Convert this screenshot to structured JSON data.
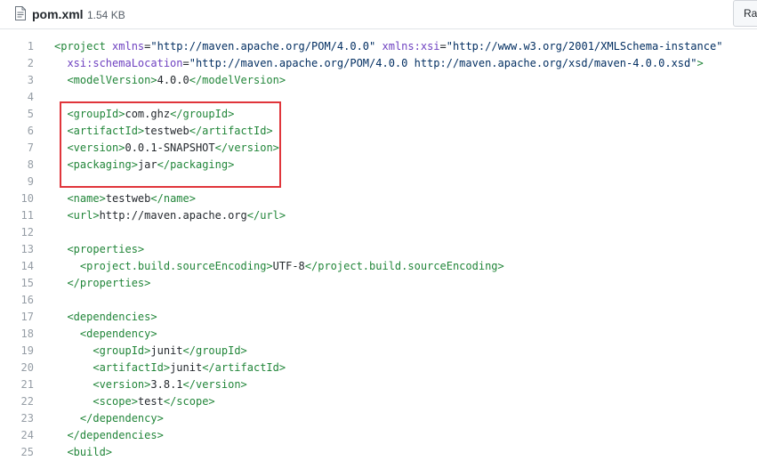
{
  "file": {
    "name": "pom.xml",
    "size": "1.54 KB",
    "raw_label": "Raw",
    "icon": "file-code-icon"
  },
  "colors": {
    "tag": "#22863a",
    "attr": "#6f42c1",
    "string": "#032f62",
    "text": "#24292e",
    "line_number": "#959da5",
    "highlight_border": "#e0353b"
  },
  "lines": [
    {
      "n": "1",
      "segs": [
        [
          "tag",
          "<project "
        ],
        [
          "attr",
          "xmlns"
        ],
        [
          "text",
          "="
        ],
        [
          "str",
          "\"http://maven.apache.org/POM/4.0.0\""
        ],
        [
          "text",
          " "
        ],
        [
          "attr",
          "xmlns:xsi"
        ],
        [
          "text",
          "="
        ],
        [
          "str",
          "\"http://www.w3.org/2001/XMLSchema-instance\""
        ]
      ]
    },
    {
      "n": "2",
      "segs": [
        [
          "text",
          "  "
        ],
        [
          "attr",
          "xsi:schemaLocation"
        ],
        [
          "text",
          "="
        ],
        [
          "str",
          "\"http://maven.apache.org/POM/4.0.0 http://maven.apache.org/xsd/maven-4.0.0.xsd\""
        ],
        [
          "tag",
          ">"
        ]
      ]
    },
    {
      "n": "3",
      "segs": [
        [
          "text",
          "  "
        ],
        [
          "tag",
          "<modelVersion>"
        ],
        [
          "text",
          "4.0.0"
        ],
        [
          "tag",
          "</modelVersion>"
        ]
      ]
    },
    {
      "n": "4",
      "segs": []
    },
    {
      "n": "5",
      "segs": [
        [
          "text",
          "  "
        ],
        [
          "tag",
          "<groupId>"
        ],
        [
          "text",
          "com.ghz"
        ],
        [
          "tag",
          "</groupId>"
        ]
      ]
    },
    {
      "n": "6",
      "segs": [
        [
          "text",
          "  "
        ],
        [
          "tag",
          "<artifactId>"
        ],
        [
          "text",
          "testweb"
        ],
        [
          "tag",
          "</artifactId>"
        ]
      ]
    },
    {
      "n": "7",
      "segs": [
        [
          "text",
          "  "
        ],
        [
          "tag",
          "<version>"
        ],
        [
          "text",
          "0.0.1-SNAPSHOT"
        ],
        [
          "tag",
          "</version>"
        ]
      ]
    },
    {
      "n": "8",
      "segs": [
        [
          "text",
          "  "
        ],
        [
          "tag",
          "<packaging>"
        ],
        [
          "text",
          "jar"
        ],
        [
          "tag",
          "</packaging>"
        ]
      ]
    },
    {
      "n": "9",
      "segs": []
    },
    {
      "n": "10",
      "segs": [
        [
          "text",
          "  "
        ],
        [
          "tag",
          "<name>"
        ],
        [
          "text",
          "testweb"
        ],
        [
          "tag",
          "</name>"
        ]
      ]
    },
    {
      "n": "11",
      "segs": [
        [
          "text",
          "  "
        ],
        [
          "tag",
          "<url>"
        ],
        [
          "text",
          "http://maven.apache.org"
        ],
        [
          "tag",
          "</url>"
        ]
      ]
    },
    {
      "n": "12",
      "segs": []
    },
    {
      "n": "13",
      "segs": [
        [
          "text",
          "  "
        ],
        [
          "tag",
          "<properties>"
        ]
      ]
    },
    {
      "n": "14",
      "segs": [
        [
          "text",
          "    "
        ],
        [
          "tag",
          "<project.build.sourceEncoding>"
        ],
        [
          "text",
          "UTF-8"
        ],
        [
          "tag",
          "</project.build.sourceEncoding>"
        ]
      ]
    },
    {
      "n": "15",
      "segs": [
        [
          "text",
          "  "
        ],
        [
          "tag",
          "</properties>"
        ]
      ]
    },
    {
      "n": "16",
      "segs": []
    },
    {
      "n": "17",
      "segs": [
        [
          "text",
          "  "
        ],
        [
          "tag",
          "<dependencies>"
        ]
      ]
    },
    {
      "n": "18",
      "segs": [
        [
          "text",
          "    "
        ],
        [
          "tag",
          "<dependency>"
        ]
      ]
    },
    {
      "n": "19",
      "segs": [
        [
          "text",
          "      "
        ],
        [
          "tag",
          "<groupId>"
        ],
        [
          "text",
          "junit"
        ],
        [
          "tag",
          "</groupId>"
        ]
      ]
    },
    {
      "n": "20",
      "segs": [
        [
          "text",
          "      "
        ],
        [
          "tag",
          "<artifactId>"
        ],
        [
          "text",
          "junit"
        ],
        [
          "tag",
          "</artifactId>"
        ]
      ]
    },
    {
      "n": "21",
      "segs": [
        [
          "text",
          "      "
        ],
        [
          "tag",
          "<version>"
        ],
        [
          "text",
          "3.8.1"
        ],
        [
          "tag",
          "</version>"
        ]
      ]
    },
    {
      "n": "22",
      "segs": [
        [
          "text",
          "      "
        ],
        [
          "tag",
          "<scope>"
        ],
        [
          "text",
          "test"
        ],
        [
          "tag",
          "</scope>"
        ]
      ]
    },
    {
      "n": "23",
      "segs": [
        [
          "text",
          "    "
        ],
        [
          "tag",
          "</dependency>"
        ]
      ]
    },
    {
      "n": "24",
      "segs": [
        [
          "text",
          "  "
        ],
        [
          "tag",
          "</dependencies>"
        ]
      ]
    },
    {
      "n": "25",
      "segs": [
        [
          "text",
          "  "
        ],
        [
          "tag",
          "<build>"
        ]
      ]
    }
  ]
}
